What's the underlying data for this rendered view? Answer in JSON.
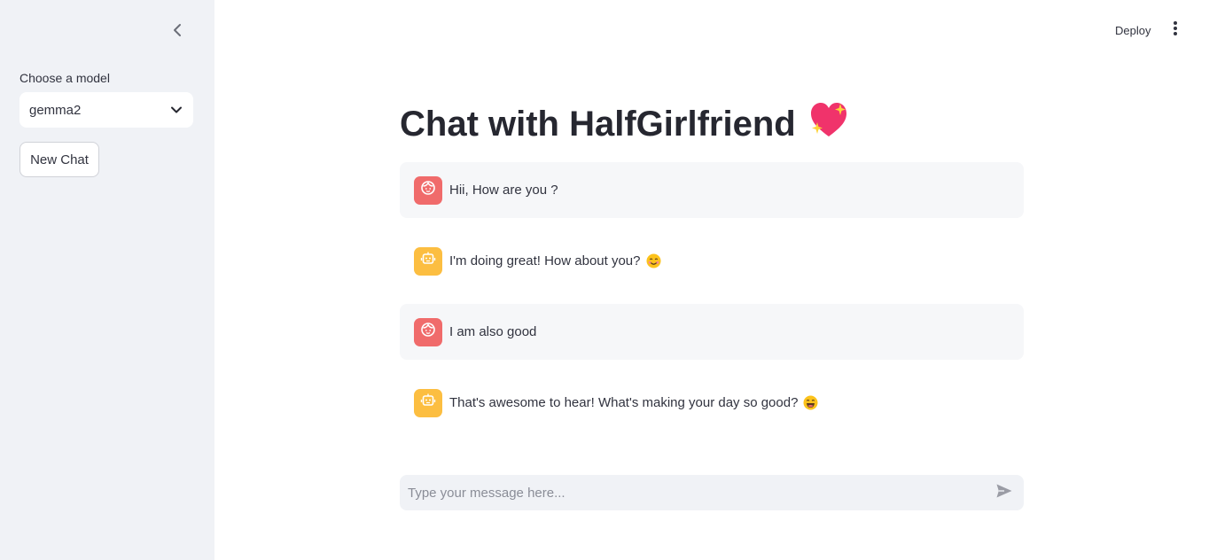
{
  "sidebar": {
    "collapse_icon": "chevron-left-icon",
    "model_label": "Choose a model",
    "model_selected": "gemma2",
    "new_chat_label": "New Chat"
  },
  "header": {
    "deploy_label": "Deploy",
    "menu_icon": "vertical-ellipsis-icon"
  },
  "main": {
    "title": "Chat with HalfGirlfriend",
    "title_emoji": "sparkling-heart",
    "messages": [
      {
        "role": "user",
        "text": "Hii, How are you ?",
        "avatar_icon": "user-face-icon"
      },
      {
        "role": "assistant",
        "text": "I'm doing great! How about you?",
        "emoji": "smiling-face",
        "avatar_icon": "robot-icon"
      },
      {
        "role": "user",
        "text": "I am also good",
        "avatar_icon": "user-face-icon"
      },
      {
        "role": "assistant",
        "text": "That's awesome to hear! What's making your day so good?",
        "emoji": "grinning-face",
        "avatar_icon": "robot-icon"
      }
    ]
  },
  "chat_input": {
    "placeholder": "Type your message here...",
    "value": "",
    "send_icon": "send-icon"
  },
  "colors": {
    "sidebar_bg": "#f0f2f6",
    "user_avatar": "#f06b6b",
    "assistant_avatar": "#fcbe41",
    "user_message_bg": "#f6f7f9",
    "text": "#31333f"
  }
}
